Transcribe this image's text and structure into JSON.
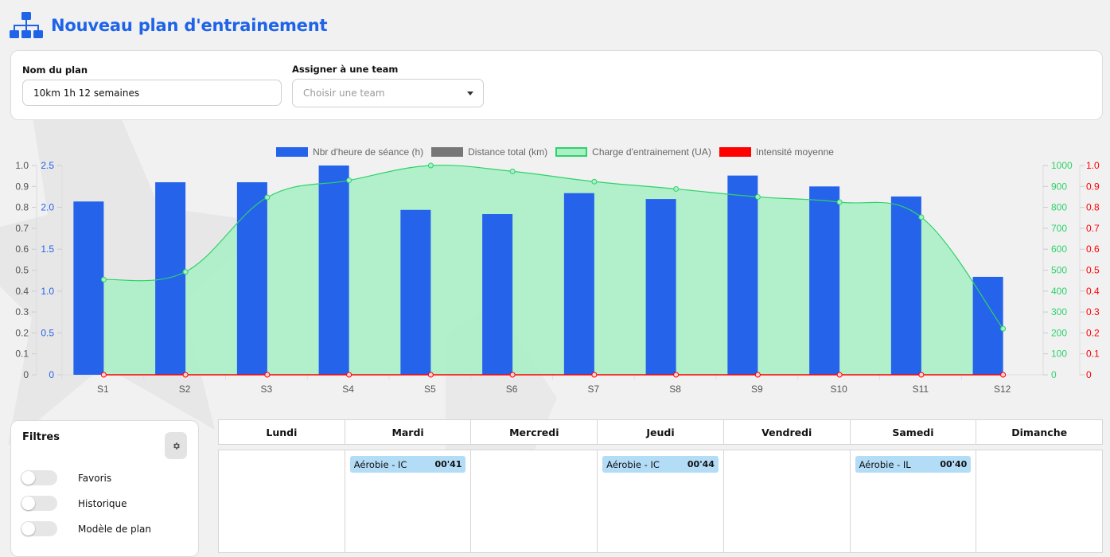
{
  "header": {
    "title": "Nouveau plan d'entrainement",
    "icon": "sitemap-icon"
  },
  "form": {
    "plan_name_label": "Nom du plan",
    "plan_name_value": "10km 1h 12 semaines",
    "team_label": "Assigner à une team",
    "team_placeholder": "Choisir une team"
  },
  "chart_data": {
    "type": "bar",
    "categories": [
      "S1",
      "S2",
      "S3",
      "S4",
      "S5",
      "S6",
      "S7",
      "S8",
      "S9",
      "S10",
      "S11",
      "S12"
    ],
    "series": [
      {
        "name": "Nbr d'heure de séance (h)",
        "kind": "bar",
        "axis": "y_hours",
        "color": "#2563eb",
        "values": [
          2.07,
          2.3,
          2.3,
          2.5,
          1.97,
          1.92,
          2.17,
          2.1,
          2.38,
          2.25,
          2.13,
          1.17
        ]
      },
      {
        "name": "Distance total (km)",
        "kind": "bar",
        "axis": "y_dist",
        "color": "#777777",
        "values": [
          0,
          0,
          0,
          0,
          0,
          0,
          0,
          0,
          0,
          0,
          0,
          0
        ]
      },
      {
        "name": "Charge d'entrainement (UA)",
        "kind": "area",
        "axis": "y_load",
        "color": "#2ed26a",
        "fill": "#abefc6",
        "values": [
          455,
          492,
          848,
          929,
          1000,
          972,
          923,
          888,
          850,
          825,
          753,
          220
        ]
      },
      {
        "name": "Intensité moyenne",
        "kind": "line",
        "axis": "y_int",
        "color": "#ff0000",
        "values": [
          0,
          0,
          0,
          0,
          0,
          0,
          0,
          0,
          0,
          0,
          0,
          0
        ]
      }
    ],
    "axes": {
      "y_dist": {
        "ticks": [
          "1.0",
          "0.9",
          "0.8",
          "0.7",
          "0.6",
          "0.5",
          "0.4",
          "0.3",
          "0.2",
          "0.1",
          "0"
        ],
        "range": [
          0,
          1
        ],
        "color": "#666666"
      },
      "y_hours": {
        "ticks": [
          "2.5",
          "2.0",
          "1.5",
          "1.0",
          "0.5",
          "0"
        ],
        "range": [
          0,
          2.5
        ],
        "color": "#2563eb"
      },
      "y_load": {
        "ticks": [
          "1000",
          "900",
          "800",
          "700",
          "600",
          "500",
          "400",
          "300",
          "200",
          "100",
          "0"
        ],
        "range": [
          0,
          1000
        ],
        "color": "#2ed26a"
      },
      "y_int": {
        "ticks": [
          "1.0",
          "0.9",
          "0.8",
          "0.7",
          "0.6",
          "0.5",
          "0.4",
          "0.3",
          "0.2",
          "0.1",
          "0"
        ],
        "range": [
          0,
          1
        ],
        "color": "#ff0000"
      }
    },
    "legend_position": "top-center",
    "grid": false
  },
  "filters": {
    "title": "Filtres",
    "items": [
      {
        "label": "Favoris"
      },
      {
        "label": "Historique"
      },
      {
        "label": "Modèle de plan"
      }
    ]
  },
  "calendar": {
    "days": [
      "Lundi",
      "Mardi",
      "Mercredi",
      "Jeudi",
      "Vendredi",
      "Samedi",
      "Dimanche"
    ],
    "sessions": [
      {
        "day_index": 1,
        "label": "Aérobie - IC",
        "duration": "00'41"
      },
      {
        "day_index": 3,
        "label": "Aérobie - IC",
        "duration": "00'44"
      },
      {
        "day_index": 5,
        "label": "Aérobie - IL",
        "duration": "00'40"
      }
    ]
  }
}
